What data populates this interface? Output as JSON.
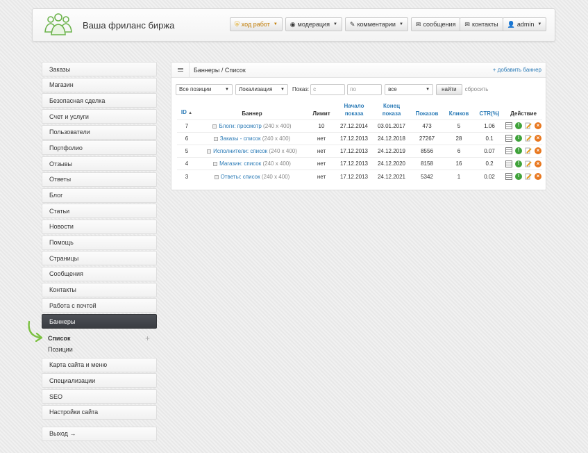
{
  "header": {
    "site_title": "Ваша фриланс биржа",
    "nav": [
      {
        "label": "ход работ",
        "icon": "shield-icon",
        "dropdown": true
      },
      {
        "label": "модерация",
        "icon": "eye-icon",
        "dropdown": true
      },
      {
        "label": "комментарии",
        "icon": "pencil-icon",
        "dropdown": true
      },
      {
        "label": "сообщения",
        "icon": "envelope-icon",
        "dropdown": false
      },
      {
        "label": "контакты",
        "icon": "envelope-icon",
        "dropdown": false
      },
      {
        "label": "admin",
        "icon": "user-icon",
        "dropdown": true
      }
    ]
  },
  "sidebar": {
    "items": [
      "Заказы",
      "Магазин",
      "Безопасная сделка",
      "Счет и услуги",
      "Пользователи",
      "Портфолио",
      "Отзывы",
      "Ответы",
      "Блог",
      "Статьи",
      "Новости",
      "Помощь",
      "Страницы",
      "Сообщения",
      "Контакты",
      "Работа с почтой"
    ],
    "active": "Баннеры",
    "subitems": [
      "Список",
      "Позиции"
    ],
    "add_symbol": "+",
    "items_after": [
      "Карта сайта и меню",
      "Специализации",
      "SEO",
      "Настройки сайта"
    ],
    "exit": "Выход →"
  },
  "panel": {
    "breadcrumb": "Баннеры / Список",
    "add_link": "+ добавить баннер",
    "filters": {
      "position": "Все позиции",
      "localization": "Локализация",
      "show_label": "Показ:",
      "from_placeholder": "с",
      "to_placeholder": "по",
      "status": "все",
      "find": "найти",
      "reset": "сбросить"
    },
    "columns": {
      "id": "ID",
      "banner": "Баннер",
      "limit": "Лимит",
      "start_1": "Начало",
      "start_2": "показа",
      "end_1": "Конец",
      "end_2": "показа",
      "shows": "Показов",
      "clicks": "Кликов",
      "ctr": "CTR(%)",
      "action": "Действие"
    },
    "rows": [
      {
        "id": "7",
        "name": "Блоги: просмотр",
        "size": "(240 x 400)",
        "limit": "10",
        "start": "27.12.2014",
        "end": "03.01.2017",
        "shows": "473",
        "clicks": "5",
        "ctr": "1.06"
      },
      {
        "id": "6",
        "name": "Заказы - список",
        "size": "(240 x 400)",
        "limit": "нет",
        "start": "17.12.2013",
        "end": "24.12.2018",
        "shows": "27267",
        "clicks": "28",
        "ctr": "0.1"
      },
      {
        "id": "5",
        "name": "Исполнители: список",
        "size": "(240 x 400)",
        "limit": "нет",
        "start": "17.12.2013",
        "end": "24.12.2019",
        "shows": "8556",
        "clicks": "6",
        "ctr": "0.07"
      },
      {
        "id": "4",
        "name": "Магазин: список",
        "size": "(240 x 400)",
        "limit": "нет",
        "start": "17.12.2013",
        "end": "24.12.2020",
        "shows": "8158",
        "clicks": "16",
        "ctr": "0.2"
      },
      {
        "id": "3",
        "name": "Ответы: список",
        "size": "(240 x 400)",
        "limit": "нет",
        "start": "17.12.2013",
        "end": "24.12.2021",
        "shows": "5342",
        "clicks": "1",
        "ctr": "0.02"
      }
    ]
  },
  "colors": {
    "accent": "#2a7ab6",
    "active_bg": "#3a3d42",
    "ok": "#3fa23a",
    "delete": "#e8771e"
  }
}
